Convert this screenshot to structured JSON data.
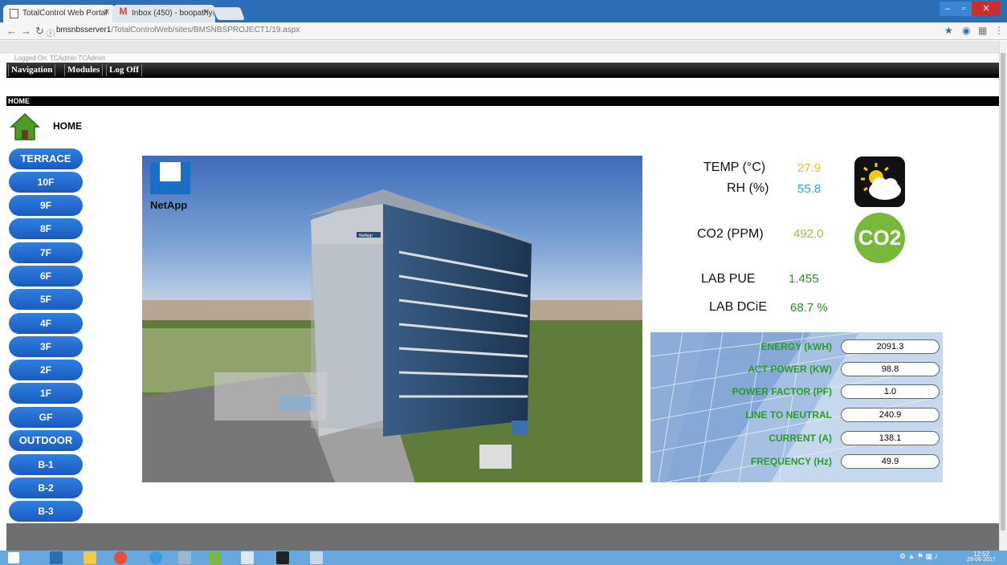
{
  "browser": {
    "tabs": [
      {
        "title": "TotalControl Web Portal"
      },
      {
        "title": "Inbox (450) - boopathy@"
      }
    ],
    "url_host": "bmsnbsserver1",
    "url_path": "/TotalControlWeb/sites/BMSNBSPROJECT1/19.aspx"
  },
  "header": {
    "logged_on": "Logged On: TCAdmin TCAdmin",
    "menu": [
      "Navigation",
      "Modules",
      "Log Off"
    ],
    "breadcrumb": "HOME",
    "home_label": "HOME"
  },
  "floors": [
    "TERRACE",
    "10F",
    "9F",
    "8F",
    "7F",
    "6F",
    "5F",
    "4F",
    "3F",
    "2F",
    "1F",
    "GF",
    "OUTDOOR",
    "B-1",
    "B-2",
    "B-3"
  ],
  "photo": {
    "brand": "NetApp",
    "sign": "NetApp"
  },
  "readings": {
    "temp_label": "TEMP (°C)",
    "temp_value": "27.9",
    "rh_label": "RH (%)",
    "rh_value": "55.8",
    "co2_label": "CO2 (PPM)",
    "co2_value": "492.0",
    "co2_icon": "CO2",
    "pue_label": "LAB PUE",
    "pue_value": "1.455",
    "dcie_label": "LAB DCiE",
    "dcie_value": "68.7 %"
  },
  "energy": [
    {
      "label": "ENERGY (kWH)",
      "value": "2091.3"
    },
    {
      "label": "ACT POWER (KW)",
      "value": "98.8"
    },
    {
      "label": "POWER FACTOR (PF)",
      "value": "1.0"
    },
    {
      "label": "LINE TO NEUTRAL",
      "value": "240.9"
    },
    {
      "label": "CURRENT (A)",
      "value": "138.1"
    },
    {
      "label": "FREQUENCY (Hz)",
      "value": "49.9"
    }
  ],
  "colors": {
    "temp": "#f2c11a",
    "rh": "#29a8d8",
    "co2": "#8cc63f",
    "pue": "#2e8b2e",
    "dcie": "#2e8b2e",
    "floor_button": "#1f66cc",
    "energy_label": "#2b9a2b"
  },
  "taskbar": {
    "time": "12:52",
    "date": "29-06-2017"
  }
}
